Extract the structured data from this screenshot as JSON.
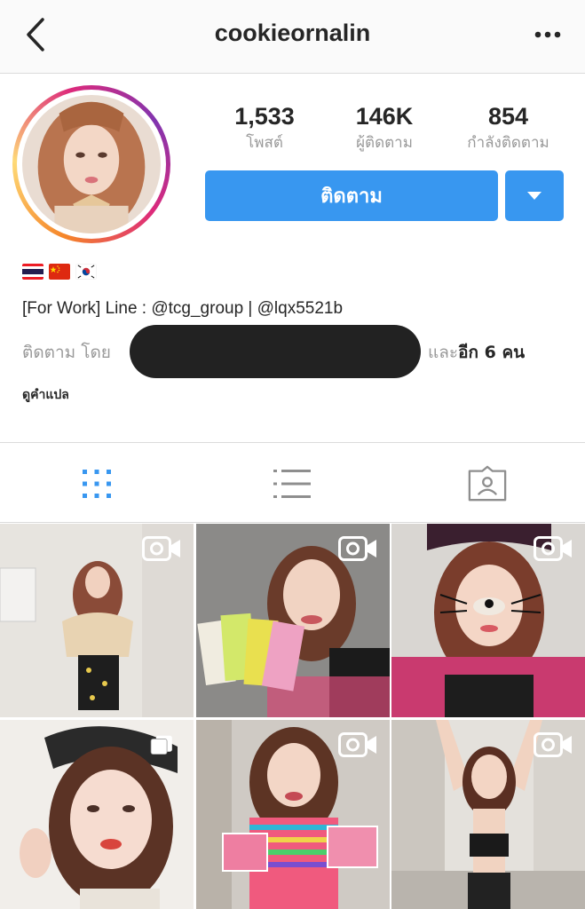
{
  "header": {
    "username": "cookieornalin"
  },
  "stats": {
    "posts_value": "1,533",
    "posts_label": "โพสต์",
    "followers_value": "146K",
    "followers_label": "ผู้ติดตาม",
    "following_value": "854",
    "following_label": "กำลังติดตาม"
  },
  "actions": {
    "follow_label": "ติดตาม"
  },
  "bio": {
    "flags": [
      "thailand-flag",
      "china-flag",
      "south-korea-flag"
    ],
    "text": "[For Work] Line : @tcg_group | @lqx5521b",
    "followed_by_prefix": "ติดตาม โดย",
    "followed_by_and": "และ",
    "followed_by_more": "อีก 6 คน",
    "translate_label": "ดูคำแปล"
  },
  "tabs": [
    "grid-tab",
    "list-tab",
    "tagged-tab"
  ],
  "grid": {
    "items": [
      {
        "type": "video"
      },
      {
        "type": "video"
      },
      {
        "type": "video"
      },
      {
        "type": "carousel"
      },
      {
        "type": "video"
      },
      {
        "type": "video"
      }
    ]
  },
  "colors": {
    "accent": "#3897f0",
    "muted_text": "#999999",
    "divider": "#dbdbdb"
  }
}
